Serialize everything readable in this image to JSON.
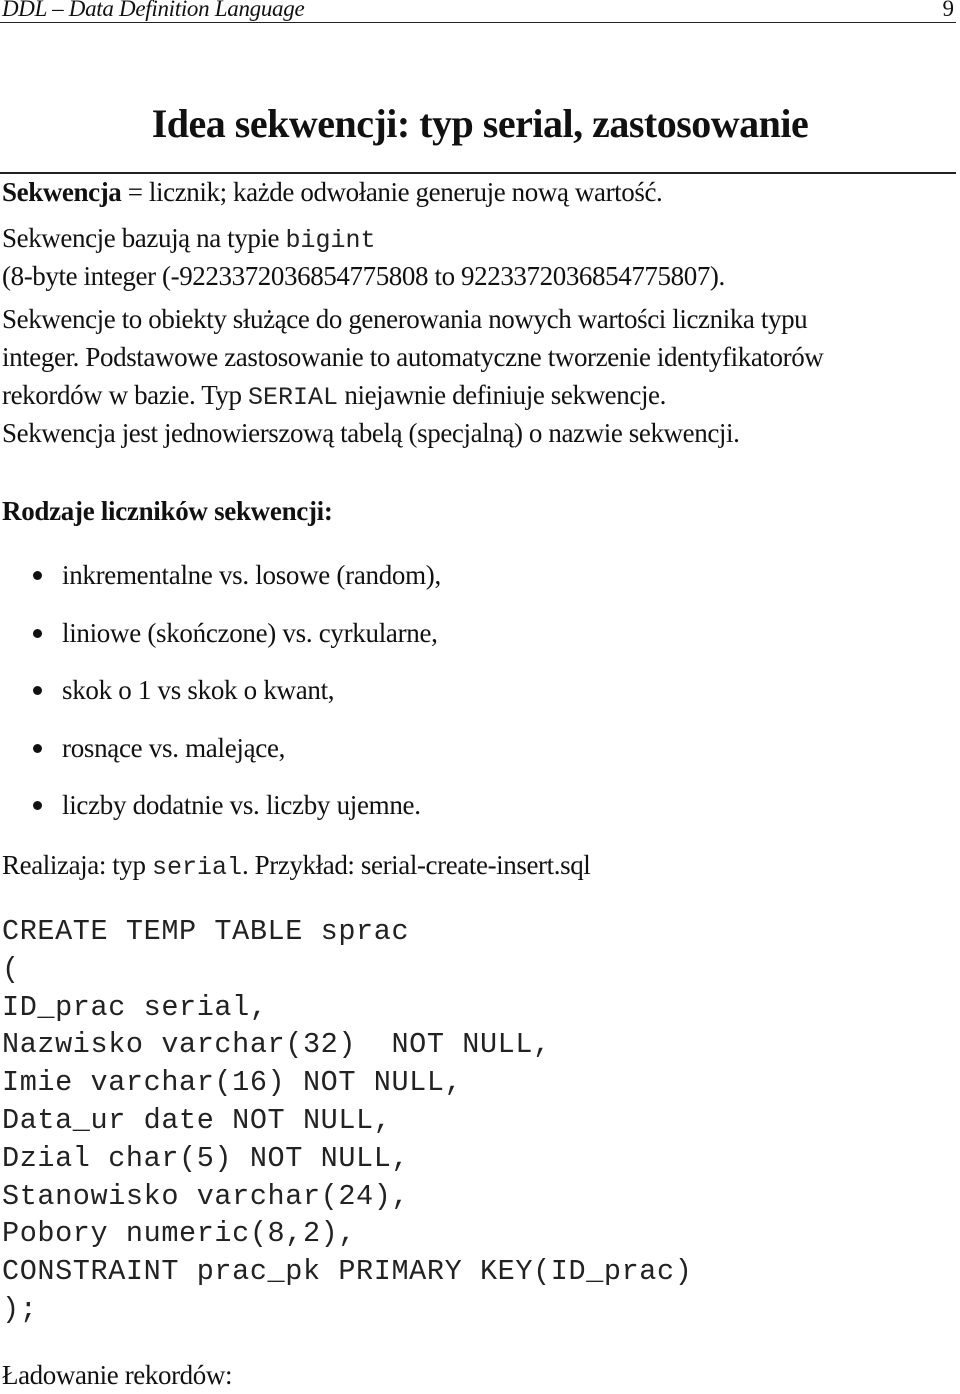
{
  "header": {
    "running_title": "DDL – Data Definition Language",
    "page_number": "9"
  },
  "slide": {
    "title": "Idea sekwencji: typ serial, zastosowanie"
  },
  "intro": {
    "definition_term": "Sekwencja",
    "definition_rest": " = licznik; każde odwołanie generuje nową wartość.",
    "bigint_prefix": "Sekwencje bazują na typie ",
    "bigint_code": "bigint",
    "range_text": "(8-byte integer (-9223372036854775808 to 9223372036854775807).",
    "para_line1": "Sekwencje to obiekty służące do generowania nowych wartości licznika typu",
    "para_line2": "integer. Podstawowe zastosowanie to automatyczne tworzenie identyfikatorów",
    "para_line3_prefix": "rekordów w bazie. Typ ",
    "para_line3_code": "SERIAL",
    "para_line3_suffix": " niejawnie definiuje sekwencje.",
    "para_line4": "Sekwencja jest jednowierszową tabelą (specjalną) o nazwie sekwencji."
  },
  "counter_types": {
    "heading": "Rodzaje liczników sekwencji:",
    "items": [
      "inkrementalne vs. losowe (random),",
      "liniowe (skończone) vs. cyrkularne,",
      "skok o 1 vs skok o kwant,",
      "rosnące vs. malejące,",
      "liczby dodatnie vs. liczby ujemne."
    ]
  },
  "realization": {
    "prefix": "Realizaja: typ ",
    "code": "serial",
    "suffix": ". Przykład: serial-create-insert.sql"
  },
  "code_listing": {
    "lines": [
      "CREATE TEMP TABLE sprac",
      "(",
      "ID_prac serial,",
      "Nazwisko varchar(32)  NOT NULL,",
      "Imie varchar(16) NOT NULL,",
      "Data_ur date NOT NULL,",
      "Dzial char(5) NOT NULL,",
      "Stanowisko varchar(24),",
      "Pobory numeric(8,2),",
      "CONSTRAINT prac_pk PRIMARY KEY(ID_prac)",
      ");"
    ]
  },
  "footer_section": {
    "heading": "Ładowanie rekordów:"
  }
}
